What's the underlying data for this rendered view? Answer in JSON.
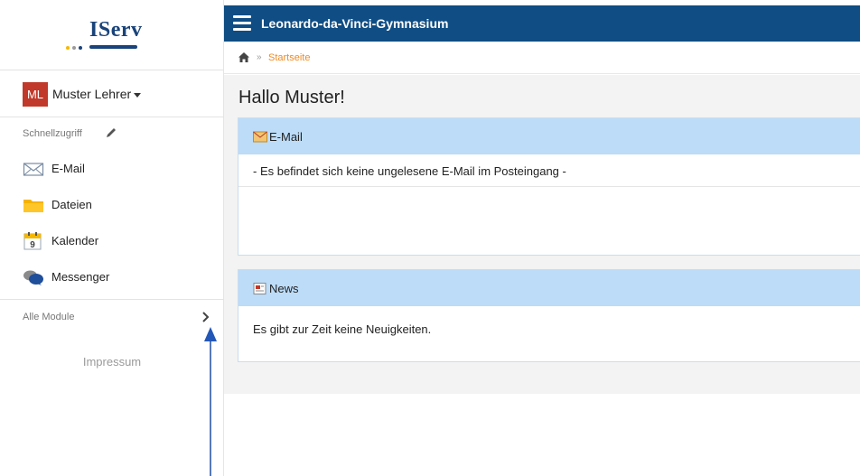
{
  "app": {
    "logo_text": "IServ",
    "school_name": "Leonardo-da-Vinci-Gymnasium"
  },
  "colors": {
    "topbar": "#0f4d84",
    "panel_header": "#bcdcf8",
    "breadcrumb_link": "#f08a24",
    "avatar": "#c0392b",
    "logo": "#19437a"
  },
  "user": {
    "initials": "ML",
    "name": "Muster Lehrer"
  },
  "sidebar": {
    "quick_access_label": "Schnellzugriff",
    "items": [
      {
        "label": "E-Mail",
        "icon": "envelope-icon"
      },
      {
        "label": "Dateien",
        "icon": "folder-icon"
      },
      {
        "label": "Kalender",
        "icon": "calendar-icon"
      },
      {
        "label": "Messenger",
        "icon": "chat-bubbles-icon"
      }
    ],
    "all_modules_label": "Alle Module",
    "impressum_label": "Impressum"
  },
  "breadcrumb": {
    "separator": "»",
    "current": "Startseite"
  },
  "main": {
    "greeting": "Hallo Muster!",
    "email_panel": {
      "title": "E-Mail",
      "message": "- Es befindet sich keine ungelesene E-Mail im Posteingang -"
    },
    "news_panel": {
      "title": "News",
      "message": "Es gibt zur Zeit keine Neuigkeiten."
    }
  }
}
